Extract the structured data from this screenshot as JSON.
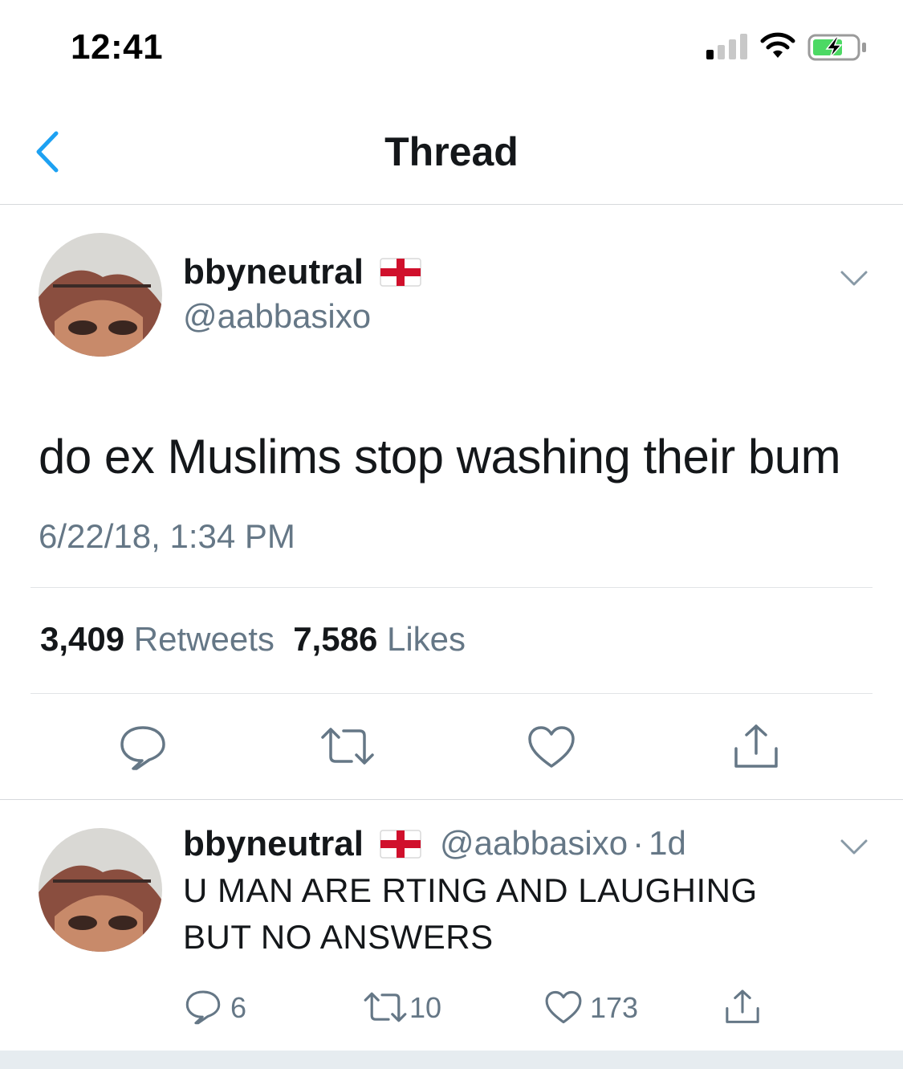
{
  "status_bar": {
    "time": "12:41"
  },
  "header": {
    "title": "Thread"
  },
  "main_tweet": {
    "display_name": "bbyneutral",
    "handle": "@aabbasixo",
    "text": "do ex Muslims stop washing their bum",
    "timestamp": "6/22/18, 1:34 PM",
    "retweets_count": "3,409",
    "retweets_label": "Retweets",
    "likes_count": "7,586",
    "likes_label": "Likes"
  },
  "reply_tweet": {
    "display_name": "bbyneutral",
    "handle": "@aabbasixo",
    "separator": "·",
    "age": "1d",
    "line1": "U MAN ARE RTING AND LAUGHING",
    "line2": "BUT NO ANSWERS",
    "reply_count": "6",
    "retweet_count": "10",
    "like_count": "173"
  },
  "icons": {
    "back": "chevron-left-icon",
    "flag": "england-flag-icon",
    "more": "chevron-down-icon",
    "reply": "speech-bubble-icon",
    "retweet": "retweet-arrows-icon",
    "like": "heart-icon",
    "share": "share-upload-icon"
  },
  "colors": {
    "accent": "#1da1f2",
    "text": "#14171a",
    "secondary": "#657786",
    "battery": "#4cd964",
    "flag_red": "#d0102c"
  }
}
